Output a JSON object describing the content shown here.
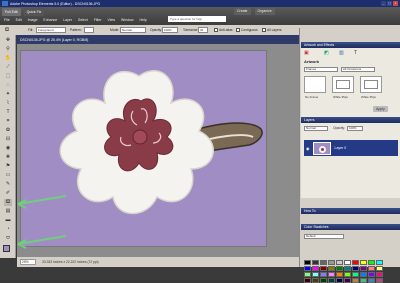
{
  "window": {
    "title": "Adobe Photoshop Elements 5.0 (Editor) - DSCN0136.JPG"
  },
  "window_controls": [
    "_",
    "▢",
    "x"
  ],
  "mode_buttons": [
    "Full Edit",
    "Quick Fix"
  ],
  "menu": [
    "File",
    "Edit",
    "Image",
    "Enhance",
    "Layer",
    "Select",
    "Filter",
    "View",
    "Window",
    "Help"
  ],
  "help": {
    "placeholder": "Type a question for help"
  },
  "top_buttons": {
    "create": "Create",
    "organize": "Organize"
  },
  "options_bar": {
    "fill_label": "Fill:",
    "fill_value": "Foreground",
    "pattern_label": "Pattern:",
    "mode_label": "Mode:",
    "mode_value": "Normal",
    "opacity_label": "Opacity:",
    "opacity_value": "100%",
    "tolerance_label": "Tolerance:",
    "tolerance_value": "32",
    "anti_alias_label": "Anti-alias",
    "contiguous_label": "Contiguous",
    "all_layers_label": "All Layers"
  },
  "document": {
    "tab_title": "DSCN0136.JPG @ 25.4% (Layer 0, RGB/8)"
  },
  "status": {
    "zoom": "25%",
    "text": "33.333 inches x 22.222 inches (72 ppi)"
  },
  "palette": {
    "artwork_header": "Artwork and Effects",
    "artwork_title": "Artwork",
    "frames_select": "Frames",
    "occasions_select": "All Occasions",
    "thumbs": [
      "No Frame",
      "White 35px",
      "White 35px"
    ],
    "apply_button": "Apply",
    "layers_header": "Layers",
    "blend_mode": "Normal",
    "opacity_label": "Opacity:",
    "opacity_value": "100%",
    "layer_name": "Layer 0",
    "how_to_header": "How To",
    "color_swatches_header": "Color Swatches",
    "swatch_set": "Default"
  },
  "swatch_colors": [
    "#000000",
    "#333333",
    "#666666",
    "#999999",
    "#cccccc",
    "#ffffff",
    "#ff0000",
    "#ffff00",
    "#00ff00",
    "#00ffff",
    "#0000ff",
    "#ff00ff",
    "#800000",
    "#808000",
    "#008000",
    "#008080",
    "#000080",
    "#800080",
    "#ff8080",
    "#ffff80",
    "#80ff80",
    "#80ffff",
    "#8080ff",
    "#ff80ff",
    "#ff8000",
    "#80ff00",
    "#00ff80",
    "#0080ff",
    "#8000ff",
    "#ff0080",
    "#400000",
    "#404000",
    "#004000",
    "#004040",
    "#000040",
    "#400040",
    "#c08040",
    "#40c080",
    "#4080c0",
    "#c04080"
  ],
  "accent": "#a08dc4",
  "arrow_color": "#6fcf7a"
}
